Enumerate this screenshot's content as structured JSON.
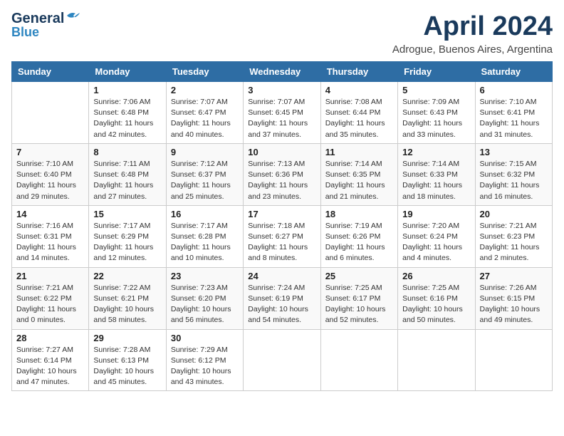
{
  "header": {
    "logo_line1": "General",
    "logo_line2": "Blue",
    "month_title": "April 2024",
    "subtitle": "Adrogue, Buenos Aires, Argentina"
  },
  "weekdays": [
    "Sunday",
    "Monday",
    "Tuesday",
    "Wednesday",
    "Thursday",
    "Friday",
    "Saturday"
  ],
  "weeks": [
    [
      {
        "day": "",
        "info": ""
      },
      {
        "day": "1",
        "info": "Sunrise: 7:06 AM\nSunset: 6:48 PM\nDaylight: 11 hours\nand 42 minutes."
      },
      {
        "day": "2",
        "info": "Sunrise: 7:07 AM\nSunset: 6:47 PM\nDaylight: 11 hours\nand 40 minutes."
      },
      {
        "day": "3",
        "info": "Sunrise: 7:07 AM\nSunset: 6:45 PM\nDaylight: 11 hours\nand 37 minutes."
      },
      {
        "day": "4",
        "info": "Sunrise: 7:08 AM\nSunset: 6:44 PM\nDaylight: 11 hours\nand 35 minutes."
      },
      {
        "day": "5",
        "info": "Sunrise: 7:09 AM\nSunset: 6:43 PM\nDaylight: 11 hours\nand 33 minutes."
      },
      {
        "day": "6",
        "info": "Sunrise: 7:10 AM\nSunset: 6:41 PM\nDaylight: 11 hours\nand 31 minutes."
      }
    ],
    [
      {
        "day": "7",
        "info": "Sunrise: 7:10 AM\nSunset: 6:40 PM\nDaylight: 11 hours\nand 29 minutes."
      },
      {
        "day": "8",
        "info": "Sunrise: 7:11 AM\nSunset: 6:48 PM\nDaylight: 11 hours\nand 27 minutes."
      },
      {
        "day": "9",
        "info": "Sunrise: 7:12 AM\nSunset: 6:37 PM\nDaylight: 11 hours\nand 25 minutes."
      },
      {
        "day": "10",
        "info": "Sunrise: 7:13 AM\nSunset: 6:36 PM\nDaylight: 11 hours\nand 23 minutes."
      },
      {
        "day": "11",
        "info": "Sunrise: 7:14 AM\nSunset: 6:35 PM\nDaylight: 11 hours\nand 21 minutes."
      },
      {
        "day": "12",
        "info": "Sunrise: 7:14 AM\nSunset: 6:33 PM\nDaylight: 11 hours\nand 18 minutes."
      },
      {
        "day": "13",
        "info": "Sunrise: 7:15 AM\nSunset: 6:32 PM\nDaylight: 11 hours\nand 16 minutes."
      }
    ],
    [
      {
        "day": "14",
        "info": "Sunrise: 7:16 AM\nSunset: 6:31 PM\nDaylight: 11 hours\nand 14 minutes."
      },
      {
        "day": "15",
        "info": "Sunrise: 7:17 AM\nSunset: 6:29 PM\nDaylight: 11 hours\nand 12 minutes."
      },
      {
        "day": "16",
        "info": "Sunrise: 7:17 AM\nSunset: 6:28 PM\nDaylight: 11 hours\nand 10 minutes."
      },
      {
        "day": "17",
        "info": "Sunrise: 7:18 AM\nSunset: 6:27 PM\nDaylight: 11 hours\nand 8 minutes."
      },
      {
        "day": "18",
        "info": "Sunrise: 7:19 AM\nSunset: 6:26 PM\nDaylight: 11 hours\nand 6 minutes."
      },
      {
        "day": "19",
        "info": "Sunrise: 7:20 AM\nSunset: 6:24 PM\nDaylight: 11 hours\nand 4 minutes."
      },
      {
        "day": "20",
        "info": "Sunrise: 7:21 AM\nSunset: 6:23 PM\nDaylight: 11 hours\nand 2 minutes."
      }
    ],
    [
      {
        "day": "21",
        "info": "Sunrise: 7:21 AM\nSunset: 6:22 PM\nDaylight: 11 hours\nand 0 minutes."
      },
      {
        "day": "22",
        "info": "Sunrise: 7:22 AM\nSunset: 6:21 PM\nDaylight: 10 hours\nand 58 minutes."
      },
      {
        "day": "23",
        "info": "Sunrise: 7:23 AM\nSunset: 6:20 PM\nDaylight: 10 hours\nand 56 minutes."
      },
      {
        "day": "24",
        "info": "Sunrise: 7:24 AM\nSunset: 6:19 PM\nDaylight: 10 hours\nand 54 minutes."
      },
      {
        "day": "25",
        "info": "Sunrise: 7:25 AM\nSunset: 6:17 PM\nDaylight: 10 hours\nand 52 minutes."
      },
      {
        "day": "26",
        "info": "Sunrise: 7:25 AM\nSunset: 6:16 PM\nDaylight: 10 hours\nand 50 minutes."
      },
      {
        "day": "27",
        "info": "Sunrise: 7:26 AM\nSunset: 6:15 PM\nDaylight: 10 hours\nand 49 minutes."
      }
    ],
    [
      {
        "day": "28",
        "info": "Sunrise: 7:27 AM\nSunset: 6:14 PM\nDaylight: 10 hours\nand 47 minutes."
      },
      {
        "day": "29",
        "info": "Sunrise: 7:28 AM\nSunset: 6:13 PM\nDaylight: 10 hours\nand 45 minutes."
      },
      {
        "day": "30",
        "info": "Sunrise: 7:29 AM\nSunset: 6:12 PM\nDaylight: 10 hours\nand 43 minutes."
      },
      {
        "day": "",
        "info": ""
      },
      {
        "day": "",
        "info": ""
      },
      {
        "day": "",
        "info": ""
      },
      {
        "day": "",
        "info": ""
      }
    ]
  ]
}
